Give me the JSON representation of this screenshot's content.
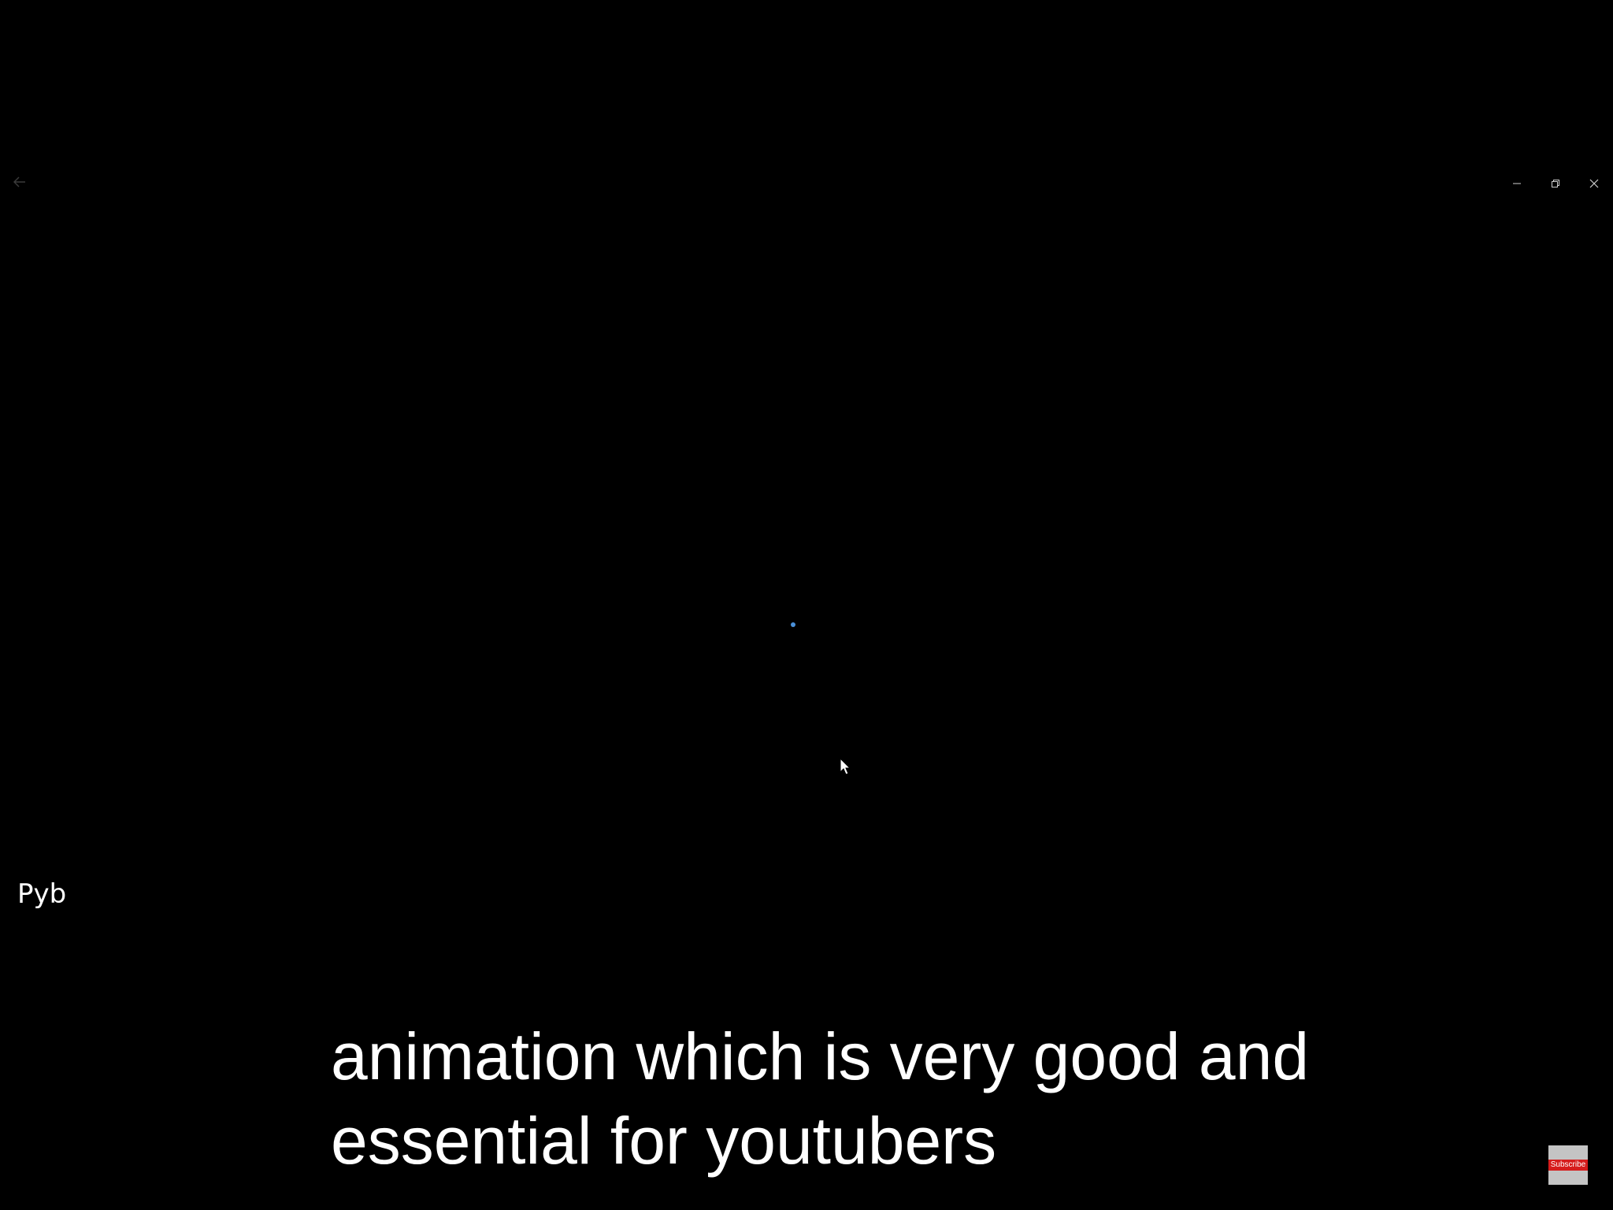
{
  "app": {
    "name": "Pyb"
  },
  "window": {
    "controls": {
      "minimize_icon": "minimize-icon",
      "restore_icon": "restore-icon",
      "close_icon": "close-icon"
    },
    "back_icon": "back-arrow-icon"
  },
  "loading": {
    "indicator_color": "#4a90d9"
  },
  "caption": {
    "line1": "animation which is very good and",
    "line2": "essential for youtubers"
  },
  "subscribe": {
    "label": "Subscribe",
    "color": "#d61c1c"
  },
  "colors": {
    "background": "#000000",
    "text": "#ffffff"
  }
}
